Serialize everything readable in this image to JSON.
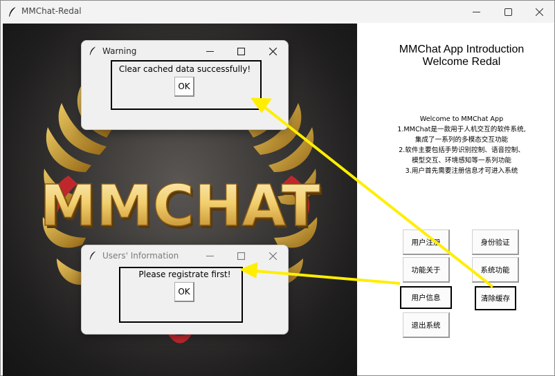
{
  "window": {
    "title": "MMChat-Redal",
    "controls": [
      "minimize-icon",
      "maximize-icon",
      "close-icon"
    ]
  },
  "poster": {
    "logo_text": "MMCHAT",
    "colors": {
      "gold": "#e8b23a",
      "cream": "#f6e4a6",
      "red": "#c0272d",
      "dark": "#1f1e1e"
    }
  },
  "intro": {
    "title_line1": "MMChat App Introduction",
    "title_line2": "Welcome Redal",
    "text_lines": [
      "Welcome to MMChat App",
      "1.MMChat是一款用于人机交互的软件系统,",
      "集成了一系列的多模态交互功能",
      "2.软件主要包括手势识别控制、语音控制、",
      "模型交互、环境感知等一系列功能",
      "3.用户首先需要注册信息才可进入系统"
    ]
  },
  "menu": {
    "register": "用户注册",
    "verify": "身份验证",
    "about": "功能关于",
    "functions": "系统功能",
    "user_info": "用户信息",
    "clear_cache": "清除缓存",
    "exit": "退出系统"
  },
  "warning_dialog": {
    "title": "Warning",
    "message": "Clear cached data successfully!",
    "ok": "OK"
  },
  "users_dialog": {
    "title": "Users' Information",
    "message": "Please registrate first!",
    "ok": "OK"
  },
  "annotation": {
    "arrow_color": "#ffee00"
  }
}
